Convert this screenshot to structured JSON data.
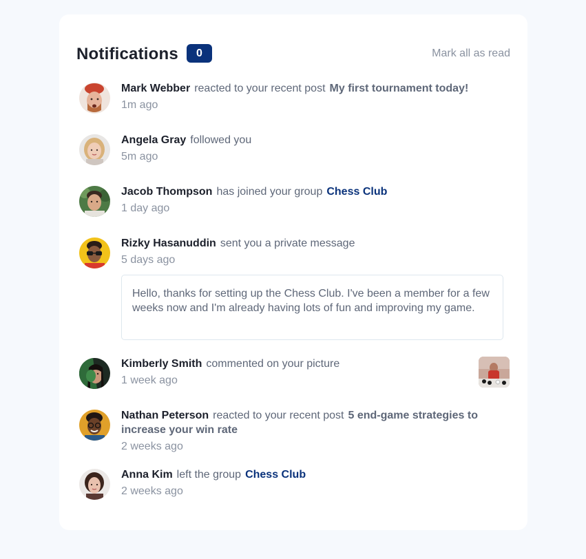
{
  "header": {
    "title": "Notifications",
    "unread_count": "0",
    "mark_all_label": "Mark all as read"
  },
  "colors": {
    "background": "#f6f9fd",
    "card": "#ffffff",
    "badge": "#0a327b",
    "accent_blue": "#0a327b",
    "name_text": "#1c202b",
    "body_text": "#5e6778",
    "muted_text": "#8a92a0"
  },
  "notifications": [
    {
      "name": "Mark Webber",
      "action": "reacted to your recent post",
      "post": "My first tournament today!",
      "group": "",
      "time": "1m ago"
    },
    {
      "name": "Angela Gray",
      "action": "followed you",
      "post": "",
      "group": "",
      "time": "5m ago"
    },
    {
      "name": "Jacob Thompson",
      "action": "has joined your group",
      "post": "",
      "group": "Chess Club",
      "time": "1 day ago"
    },
    {
      "name": "Rizky Hasanuddin",
      "action": "sent you a private message",
      "post": "",
      "group": "",
      "time": "5 days ago",
      "message": "Hello, thanks for setting up the Chess Club. I've been a member for a few weeks now and I'm already having lots of fun and improving my game."
    },
    {
      "name": "Kimberly Smith",
      "action": "commented on your picture",
      "post": "",
      "group": "",
      "time": "1 week ago"
    },
    {
      "name": "Nathan Peterson",
      "action": "reacted to your recent post",
      "post": "5 end-game strategies to increase your win rate",
      "group": "",
      "time": "2 weeks ago"
    },
    {
      "name": "Anna Kim",
      "action": "left the group",
      "post": "",
      "group": "Chess Club",
      "time": "2 weeks ago"
    }
  ]
}
